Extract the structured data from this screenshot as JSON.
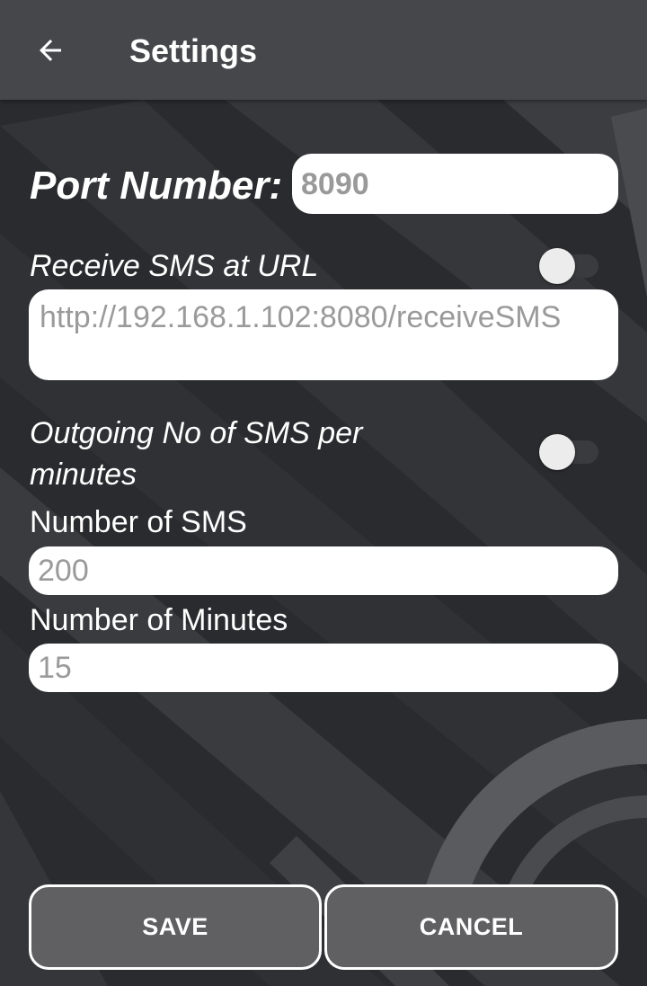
{
  "app_bar": {
    "title": "Settings",
    "back_icon": "arrow-back-icon"
  },
  "form": {
    "port_label": "Port Number:",
    "port_value": "8090",
    "receive_sms_label": "Receive SMS at URL",
    "receive_sms_enabled": false,
    "receive_sms_url_placeholder": "http://192.168.1.102:8080/receiveSMS",
    "outgoing_label": "Outgoing No of SMS per minutes",
    "outgoing_enabled": false,
    "number_of_sms_label": "Number of SMS",
    "number_of_sms_placeholder": "200",
    "number_of_minutes_label": "Number of Minutes",
    "number_of_minutes_placeholder": "15"
  },
  "actions": {
    "save_label": "SAVE",
    "cancel_label": "CANCEL"
  },
  "colors": {
    "app_bar": "#46474b",
    "background": "#2b2c2f",
    "button": "#606063",
    "field": "#ffffff"
  }
}
